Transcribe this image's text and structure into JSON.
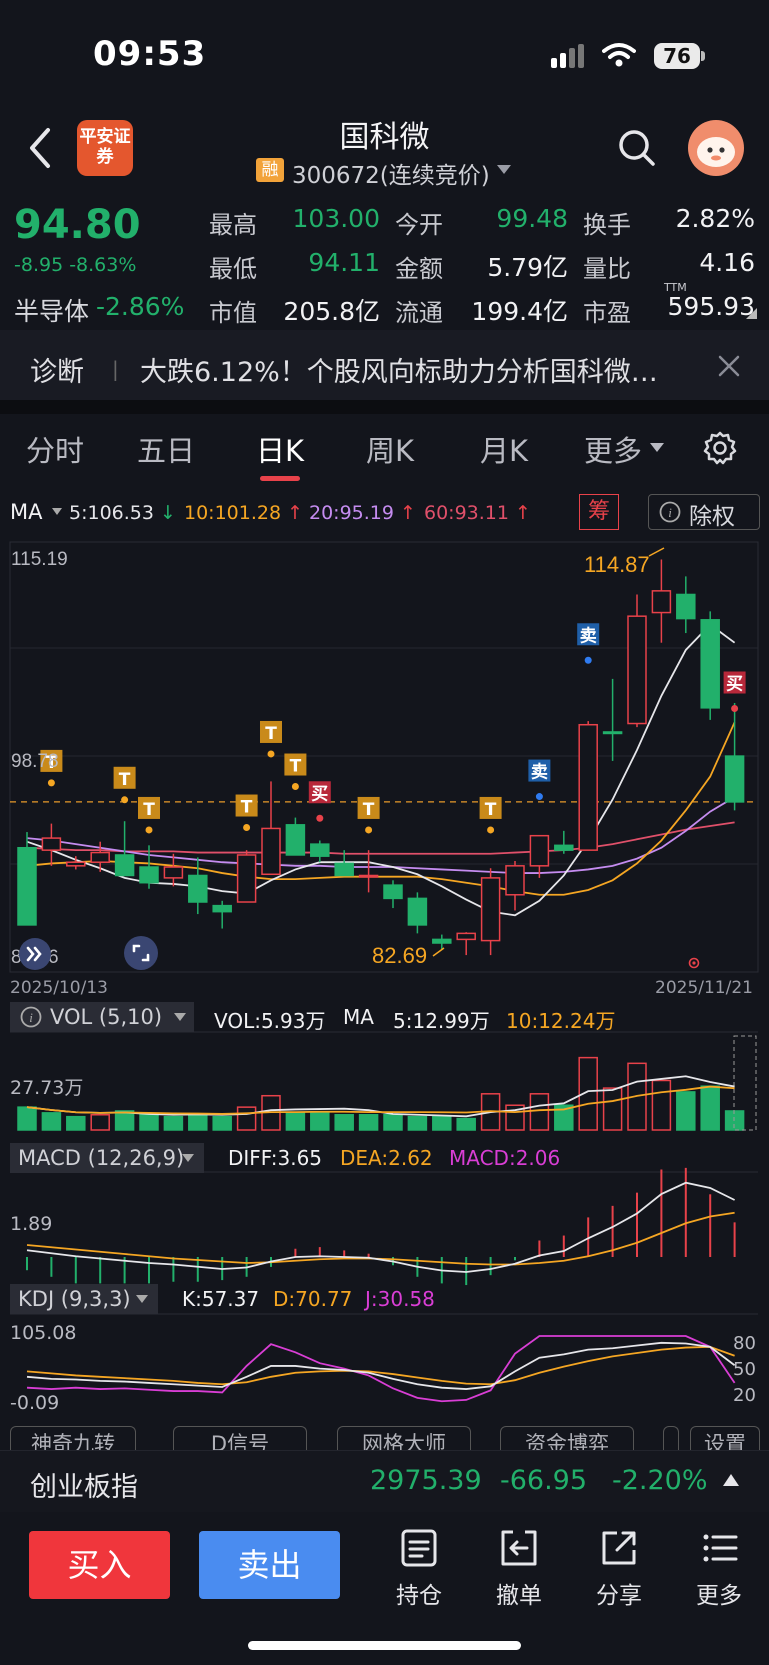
{
  "status_bar": {
    "time": "09:53",
    "battery": "76"
  },
  "header": {
    "broker_logo": "平安证券",
    "stock_name": "国科微",
    "margin_badge": "融",
    "stock_code": "300672(连续竞价)"
  },
  "quote": {
    "price": "94.80",
    "change": "-8.95 -8.63%",
    "sector_name": "半导体",
    "sector_change": "-2.86%",
    "rows": [
      [
        {
          "label": "最高",
          "value": "103.00",
          "tone": "green"
        },
        {
          "label": "今开",
          "value": "99.48",
          "tone": "green"
        },
        {
          "label": "换手",
          "value": "2.82%",
          "tone": "white"
        }
      ],
      [
        {
          "label": "最低",
          "value": "94.11",
          "tone": "green"
        },
        {
          "label": "金额",
          "value": "5.79亿",
          "tone": "white"
        },
        {
          "label": "量比",
          "value": "4.16",
          "tone": "white"
        }
      ],
      [
        {
          "label": "市值",
          "value": "205.8亿",
          "tone": "white"
        },
        {
          "label": "流通",
          "value": "199.4亿",
          "tone": "white"
        },
        {
          "label": "市盈",
          "value": "595.93",
          "tone": "white"
        }
      ]
    ],
    "pe_sup": "TTM"
  },
  "news": {
    "label": "诊断",
    "separator": "|",
    "text": "大跌6.12%！个股风向标助力分析国科微…"
  },
  "tabs": [
    "分时",
    "五日",
    "日K",
    "周K",
    "月K",
    "更多"
  ],
  "active_tab": "日K",
  "ma_legend": {
    "label": "MA",
    "items": [
      {
        "text": "5:106.53",
        "arrow": "↓",
        "color": "#e6e6ea",
        "arrow_color": "#22b06b"
      },
      {
        "text": "10:101.28",
        "arrow": "↑",
        "color": "#f5a623",
        "arrow_color": "#e8424a"
      },
      {
        "text": "20:95.19",
        "arrow": "↑",
        "color": "#c58cf0",
        "arrow_color": "#e8424a"
      },
      {
        "text": "60:93.11",
        "arrow": "↑",
        "color": "#e0506a",
        "arrow_color": "#e8424a"
      }
    ],
    "chips_button": "筹",
    "exright_button": "除权"
  },
  "chart_data": {
    "type": "candlestick",
    "ylim": [
      81.36,
      115.19
    ],
    "y_tick_labels": [
      "115.19",
      "98.78",
      "81.36"
    ],
    "date_start": "2025/10/13",
    "date_end": "2025/11/21",
    "high_label": "114.87",
    "low_label": "82.69",
    "reference_price": 94.8,
    "candles": [
      {
        "o": 91.0,
        "h": 92.3,
        "l": 84.6,
        "c": 84.6
      },
      {
        "o": 90.8,
        "h": 93.0,
        "l": 89.5,
        "c": 91.8
      },
      {
        "o": 89.5,
        "h": 90.3,
        "l": 89.2,
        "c": 89.8
      },
      {
        "o": 89.8,
        "h": 91.5,
        "l": 89.0,
        "c": 90.6
      },
      {
        "o": 90.4,
        "h": 93.2,
        "l": 88.7,
        "c": 88.7
      },
      {
        "o": 89.4,
        "h": 91.2,
        "l": 87.6,
        "c": 88.1
      },
      {
        "o": 88.5,
        "h": 90.5,
        "l": 87.8,
        "c": 89.4
      },
      {
        "o": 88.7,
        "h": 90.2,
        "l": 85.5,
        "c": 86.5
      },
      {
        "o": 86.2,
        "h": 86.6,
        "l": 84.3,
        "c": 85.7
      },
      {
        "o": 86.5,
        "h": 90.8,
        "l": 86.5,
        "c": 90.4
      },
      {
        "o": 88.8,
        "h": 96.5,
        "l": 88.8,
        "c": 92.6
      },
      {
        "o": 92.9,
        "h": 93.5,
        "l": 90.4,
        "c": 90.4
      },
      {
        "o": 91.3,
        "h": 91.6,
        "l": 89.8,
        "c": 90.3
      },
      {
        "o": 89.7,
        "h": 90.8,
        "l": 88.7,
        "c": 88.7
      },
      {
        "o": 88.7,
        "h": 90.8,
        "l": 87.3,
        "c": 88.7
      },
      {
        "o": 87.9,
        "h": 88.3,
        "l": 86.0,
        "c": 86.8
      },
      {
        "o": 86.8,
        "h": 87.3,
        "l": 83.9,
        "c": 84.6
      },
      {
        "o": 83.4,
        "h": 83.8,
        "l": 82.6,
        "c": 83.1
      },
      {
        "o": 83.4,
        "h": 84.0,
        "l": 82.1,
        "c": 83.9
      },
      {
        "o": 83.3,
        "h": 89.3,
        "l": 82.1,
        "c": 88.5
      },
      {
        "o": 87.1,
        "h": 89.9,
        "l": 85.8,
        "c": 89.5
      },
      {
        "o": 89.5,
        "h": 92.0,
        "l": 88.5,
        "c": 92.0
      },
      {
        "o": 91.2,
        "h": 92.4,
        "l": 90.5,
        "c": 90.8
      },
      {
        "o": 90.8,
        "h": 101.5,
        "l": 90.8,
        "c": 101.2
      },
      {
        "o": 100.6,
        "h": 105.0,
        "l": 98.2,
        "c": 100.5
      },
      {
        "o": 101.3,
        "h": 112.0,
        "l": 101.0,
        "c": 110.2
      },
      {
        "o": 110.5,
        "h": 114.9,
        "l": 108.0,
        "c": 112.3
      },
      {
        "o": 112.0,
        "h": 113.5,
        "l": 108.8,
        "c": 110.0
      },
      {
        "o": 109.9,
        "h": 110.6,
        "l": 101.6,
        "c": 102.6
      },
      {
        "o": 98.6,
        "h": 103.0,
        "l": 94.1,
        "c": 94.8
      }
    ],
    "ma5": [
      91.5,
      90.8,
      90.0,
      89.3,
      88.5,
      88.1,
      88.0,
      87.8,
      87.4,
      87.2,
      88.3,
      89.2,
      89.8,
      89.8,
      89.8,
      89.4,
      88.8,
      87.8,
      86.7,
      85.7,
      85.4,
      86.6,
      88.7,
      91.6,
      95.0,
      99.1,
      103.6,
      107.4,
      109.5,
      108.0
    ],
    "ma10": [
      89.5,
      89.7,
      89.8,
      89.9,
      89.8,
      89.7,
      89.5,
      89.3,
      88.9,
      88.6,
      88.4,
      88.4,
      88.5,
      88.6,
      88.6,
      88.6,
      88.6,
      88.4,
      88.1,
      87.8,
      87.4,
      87.1,
      87.1,
      87.5,
      88.3,
      89.7,
      91.6,
      94.1,
      96.9,
      101.4
    ],
    "ma20": [
      91.8,
      91.6,
      91.3,
      91.0,
      90.7,
      90.4,
      90.2,
      90.0,
      89.8,
      89.7,
      89.6,
      89.5,
      89.5,
      89.4,
      89.4,
      89.4,
      89.3,
      89.2,
      89.1,
      89.0,
      88.9,
      88.9,
      89.0,
      89.2,
      89.5,
      90.1,
      91.0,
      92.4,
      94.0,
      95.2
    ],
    "ma60": [
      91.0,
      90.9,
      90.8,
      90.8,
      90.7,
      90.7,
      90.7,
      90.6,
      90.6,
      90.6,
      90.6,
      90.6,
      90.6,
      90.5,
      90.5,
      90.5,
      90.5,
      90.5,
      90.5,
      90.5,
      90.6,
      90.7,
      90.8,
      91.0,
      91.3,
      91.7,
      92.1,
      92.5,
      92.8,
      93.1
    ],
    "t_markers": [
      {
        "index": 1,
        "y": 98.2
      },
      {
        "index": 4,
        "y": 96.8
      },
      {
        "index": 5,
        "y": 94.3
      },
      {
        "index": 9,
        "y": 94.5
      },
      {
        "index": 10,
        "y": 100.6
      },
      {
        "index": 11,
        "y": 97.9
      },
      {
        "index": 14,
        "y": 94.3
      },
      {
        "index": 19,
        "y": 94.3
      }
    ],
    "t_label": "T",
    "buy_markers": [
      {
        "index": 12,
        "y": 95.6
      },
      {
        "index": 29,
        "y": 104.7
      }
    ],
    "buy_label": "买",
    "sell_markers": [
      {
        "index": 21,
        "y": 97.4
      },
      {
        "index": 23,
        "y": 108.7
      }
    ],
    "sell_label": "卖",
    "volume": {
      "ylabel_top": "27.73万",
      "red": [
        0,
        0,
        0,
        1,
        0,
        0,
        0,
        0,
        0,
        1,
        1,
        0,
        0,
        0,
        0,
        0,
        0,
        0,
        0,
        1,
        1,
        1,
        0,
        1,
        1,
        1,
        1,
        0,
        0,
        0
      ],
      "values": [
        1.2,
        0.9,
        0.7,
        0.8,
        1.0,
        0.8,
        0.7,
        0.8,
        0.7,
        1.2,
        1.8,
        0.9,
        0.9,
        0.8,
        0.8,
        0.8,
        0.7,
        0.7,
        0.6,
        1.9,
        1.3,
        1.9,
        1.3,
        3.8,
        2.2,
        3.5,
        2.6,
        2.0,
        2.3,
        1.0
      ]
    },
    "macd": {
      "y_label_1": "1.89",
      "diff": [
        0.9,
        0.5,
        0.1,
        -0.2,
        -0.5,
        -0.8,
        -1.0,
        -1.3,
        -1.6,
        -1.4,
        -0.6,
        0.0,
        0.1,
        0.0,
        -0.1,
        -0.6,
        -1.3,
        -1.8,
        -2.0,
        -1.6,
        -0.9,
        0.2,
        0.8,
        2.5,
        4.0,
        5.8,
        8.4,
        9.9,
        9.2,
        7.6
      ],
      "dea": [
        1.6,
        1.3,
        1.0,
        0.7,
        0.4,
        0.1,
        -0.2,
        -0.4,
        -0.6,
        -0.8,
        -0.7,
        -0.5,
        -0.3,
        -0.2,
        -0.2,
        -0.3,
        -0.5,
        -0.7,
        -0.9,
        -1.0,
        -1.0,
        -0.8,
        -0.5,
        0.1,
        0.9,
        1.9,
        3.2,
        4.5,
        5.4,
        5.9
      ],
      "hist": [
        -0.8,
        -1.2,
        -1.6,
        -1.6,
        -1.6,
        -1.6,
        -1.5,
        -1.5,
        -1.4,
        -1.2,
        -0.6,
        0.5,
        0.6,
        0.4,
        0.2,
        -0.5,
        -1.2,
        -1.6,
        -1.7,
        -1.1,
        -0.2,
        1.0,
        1.3,
        2.4,
        3.1,
        3.9,
        5.3,
        5.4,
        3.8,
        2.1
      ]
    },
    "kdj": {
      "y_label_top": "105.08",
      "y_label_bottom": "-0.09",
      "right_labels": [
        "80",
        "50",
        "20"
      ],
      "k": [
        40,
        37,
        36,
        34,
        33,
        31,
        29,
        27,
        25,
        40,
        56,
        56,
        52,
        50,
        46,
        37,
        29,
        24,
        22,
        26,
        48,
        68,
        73,
        80,
        82,
        86,
        90,
        89,
        84,
        57
      ],
      "d": [
        48,
        45,
        42,
        40,
        38,
        36,
        34,
        31,
        29,
        32,
        40,
        46,
        48,
        49,
        48,
        44,
        39,
        34,
        30,
        29,
        35,
        46,
        55,
        63,
        70,
        75,
        80,
        83,
        84,
        71
      ],
      "j": [
        24,
        22,
        24,
        22,
        23,
        21,
        19,
        19,
        17,
        56,
        88,
        76,
        60,
        52,
        42,
        23,
        9,
        4,
        6,
        20,
        74,
        100,
        100,
        100,
        100,
        100,
        100,
        100,
        84,
        31
      ]
    }
  },
  "volume_legend": {
    "label": "VOL (5,10)",
    "vol": "VOL:5.93万",
    "ma_label": "MA",
    "ma5": "5:12.99万",
    "ma10": "10:12.24万"
  },
  "macd_legend": {
    "label": "MACD (12,26,9)",
    "diff": "DIFF:3.65",
    "dea": "DEA:2.62",
    "macd": "MACD:2.06"
  },
  "kdj_legend": {
    "label": "KDJ (9,3,3)",
    "k": "K:57.37",
    "d": "D:70.77",
    "j": "J:30.58"
  },
  "function_row": [
    "神奇九转",
    "D信号",
    "网格大师",
    "资金博弈",
    "设置"
  ],
  "index_bar": {
    "name": "创业板指",
    "value": "2975.39",
    "change": "-66.95",
    "pct": "-2.20%"
  },
  "bottom_bar": {
    "buy": "买入",
    "sell": "卖出",
    "holdings": "持仓",
    "cancel": "撤单",
    "share": "分享",
    "more": "更多"
  }
}
